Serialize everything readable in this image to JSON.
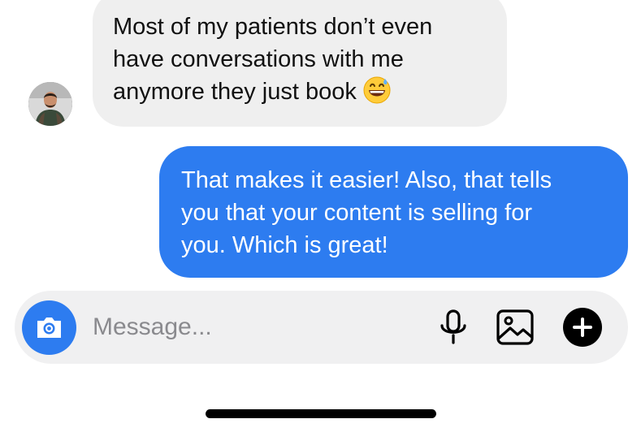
{
  "thread": {
    "incoming": {
      "lines": [
        "Most of my patients don’t even",
        "have conversations with me",
        "anymore they just book"
      ],
      "emoji": "grinning-face-with-sweat-icon"
    },
    "outgoing": {
      "lines": [
        "That makes it easier! Also, that tells",
        "you that your content is selling for",
        "you. Which is great!"
      ]
    }
  },
  "composer": {
    "placeholder": "Message...",
    "value": "",
    "icons": [
      "camera-icon",
      "microphone-icon",
      "gallery-icon",
      "plus-icon"
    ]
  },
  "colors": {
    "outgoing_bubble": "#2d7cf0",
    "incoming_bubble": "#efefef",
    "composer_bg": "#f0f0f1",
    "accent": "#2d7cf0"
  }
}
